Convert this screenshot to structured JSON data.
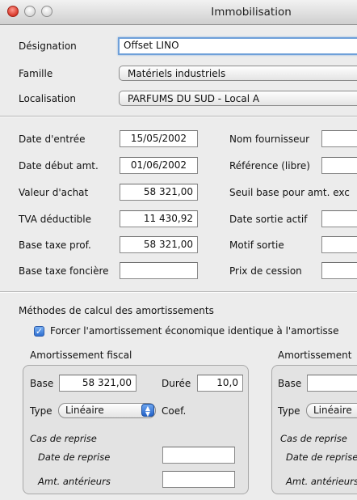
{
  "window": {
    "title": "Immobilisation"
  },
  "general": {
    "designation_label": "Désignation",
    "designation_value": "Offset LINO",
    "famille_label": "Famille",
    "famille_value": "Matériels industriels",
    "localisation_label": "Localisation",
    "localisation_value": "PARFUMS DU SUD  - Local A"
  },
  "left_fields": [
    {
      "label": "Date d'entrée",
      "value": "15/05/2002"
    },
    {
      "label": "Date début amt.",
      "value": "01/06/2002"
    },
    {
      "label": "Valeur d'achat",
      "value": "58 321,00"
    },
    {
      "label": "TVA déductible",
      "value": "11 430,92"
    },
    {
      "label": "Base taxe prof.",
      "value": "58 321,00"
    },
    {
      "label": "Base taxe foncière",
      "value": ""
    }
  ],
  "right_fields": [
    {
      "label": "Nom fournisseur",
      "value": ""
    },
    {
      "label": "Référence (libre)",
      "value": ""
    },
    {
      "label": "Seuil base pour amt. exc",
      "value": ""
    },
    {
      "label": "Date sortie actif",
      "value": ""
    },
    {
      "label": "Motif sortie",
      "value": ""
    },
    {
      "label": "Prix de cession",
      "value": ""
    }
  ],
  "methods": {
    "title": "Méthodes de calcul des amortissements",
    "checkbox_label": "Forcer l'amortissement économique identique à l'amortisse",
    "checkbox_checked": true
  },
  "fiscal": {
    "title": "Amortissement fiscal",
    "base_label": "Base",
    "base_value": "58 321,00",
    "duree_label": "Durée",
    "duree_value": "10,0",
    "type_label": "Type",
    "type_value": "Linéaire",
    "coef_label": "Coef.",
    "reprise_title": "Cas de reprise",
    "date_reprise_label": "Date de reprise",
    "date_reprise_value": "",
    "amt_anterieurs_label": "Amt. antérieurs",
    "amt_anterieurs_value": ""
  },
  "economique": {
    "title": "Amortissement",
    "base_label": "Base",
    "base_value": "",
    "type_label": "Type",
    "type_value": "Linéaire",
    "reprise_title": "Cas de reprise",
    "date_reprise_label": "Date de reprise",
    "amt_anterieurs_label": "Amt. antérieurs"
  }
}
